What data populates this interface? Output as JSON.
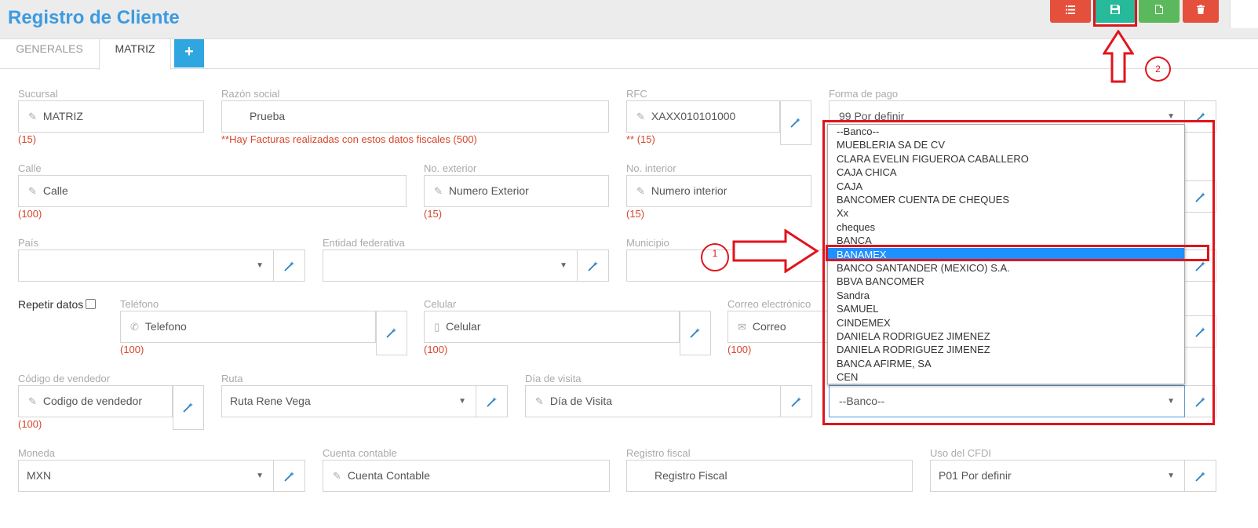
{
  "header": {
    "title": "Registro de Cliente",
    "toolbar": [
      {
        "name": "list-button",
        "icon": "list-icon",
        "color": "#e4503b"
      },
      {
        "name": "save-button",
        "icon": "save-icon",
        "color": "#26b99a"
      },
      {
        "name": "new-button",
        "icon": "file-icon",
        "color": "#5cb85c"
      },
      {
        "name": "delete-button",
        "icon": "trash-icon",
        "color": "#e4503b"
      }
    ]
  },
  "tabs": [
    {
      "label": "GENERALES",
      "active": false
    },
    {
      "label": "MATRIZ",
      "active": true
    }
  ],
  "add_tab_label": "+",
  "form": {
    "sucursal": {
      "label": "Sucursal",
      "value": "MATRIZ",
      "hint": "(15)"
    },
    "razon_social": {
      "label": "Razón social",
      "value": "Prueba",
      "hint": "**Hay Facturas realizadas con estos datos fiscales (500)"
    },
    "rfc": {
      "label": "RFC",
      "value": "XAXX010101000",
      "hint": "** (15)"
    },
    "forma_pago": {
      "label": "Forma de pago",
      "value": "99 Por definir"
    },
    "calle": {
      "label": "Calle",
      "placeholder": "Calle",
      "hint": "(100)"
    },
    "no_exterior": {
      "label": "No. exterior",
      "placeholder": "Numero Exterior",
      "hint": "(15)"
    },
    "no_interior": {
      "label": "No. interior",
      "placeholder": "Numero interior",
      "hint": "(15)"
    },
    "pais": {
      "label": "País",
      "value": ""
    },
    "entidad": {
      "label": "Entidad federativa",
      "value": ""
    },
    "municipio": {
      "label": "Municipio",
      "value": ""
    },
    "repetir": {
      "label": "Repetir datos",
      "checked": false
    },
    "telefono": {
      "label": "Teléfono",
      "placeholder": "Telefono",
      "hint": "(100)"
    },
    "celular": {
      "label": "Celular",
      "placeholder": "Celular",
      "hint": "(100)"
    },
    "correo": {
      "label": "Correo electrónico",
      "placeholder": "Correo",
      "hint": "(100)"
    },
    "codigo_vendedor": {
      "label": "Código de vendedor",
      "placeholder": "Codigo de vendedor",
      "hint": "(100)"
    },
    "ruta": {
      "label": "Ruta",
      "value": "Ruta Rene Vega"
    },
    "dia_visita": {
      "label": "Día de visita",
      "placeholder": "Día de Visita"
    },
    "banco": {
      "value": "--Banco--"
    },
    "moneda": {
      "label": "Moneda",
      "value": "MXN"
    },
    "cuenta_contable": {
      "label": "Cuenta contable",
      "placeholder": "Cuenta Contable"
    },
    "registro_fiscal": {
      "label": "Registro fiscal",
      "placeholder": "Registro Fiscal"
    },
    "uso_cfdi": {
      "label": "Uso del CFDI",
      "value": "P01 Por definir"
    }
  },
  "bank_dropdown": {
    "options": [
      "--Banco--",
      "MUEBLERIA SA DE CV",
      "CLARA EVELIN FIGUEROA CABALLERO",
      "CAJA CHICA",
      "CAJA",
      "BANCOMER CUENTA DE CHEQUES",
      "Xx",
      "cheques",
      "BANCA",
      "BANAMEX",
      "BANCO SANTANDER (MEXICO) S.A.",
      "BBVA BANCOMER",
      "Sandra",
      "SAMUEL",
      "CINDEMEX",
      "DANIELA RODRIGUEZ JIMENEZ",
      "DANIELA RODRIGUEZ JIMENEZ",
      "BANCA AFIRME, SA",
      "CEN"
    ],
    "selected": "BANAMEX"
  },
  "annotations": {
    "step1": "1",
    "step2": "2",
    "color": "#e0141c"
  }
}
